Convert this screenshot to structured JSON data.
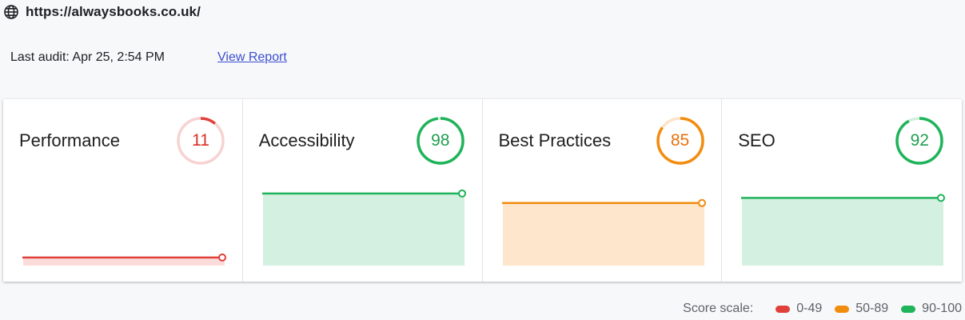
{
  "site": {
    "url": "https://alwaysbooks.co.uk/",
    "icon": "globe-icon"
  },
  "audit": {
    "last_audit": "Last audit: Apr 25, 2:54 PM",
    "view_report": "View Report"
  },
  "categories": [
    {
      "key": "performance",
      "label": "Performance",
      "score": "11",
      "value": 11,
      "level": "poor"
    },
    {
      "key": "accessibility",
      "label": "Accessibility",
      "score": "98",
      "value": 98,
      "level": "good"
    },
    {
      "key": "best-practices",
      "label": "Best Practices",
      "score": "85",
      "value": 85,
      "level": "average"
    },
    {
      "key": "seo",
      "label": "SEO",
      "score": "92",
      "value": 92,
      "level": "good"
    }
  ],
  "colors": {
    "poor": {
      "stroke": "#e0403a",
      "track": "#f6d3d1",
      "fill": "#fbdcdb",
      "text": "#d93025"
    },
    "average": {
      "stroke": "#f28c0f",
      "track": "#fde3c8",
      "fill": "#fee6cc",
      "text": "#e8710a"
    },
    "good": {
      "stroke": "#1fb35a",
      "track": "#d3efdc",
      "fill": "#d3f0e0",
      "text": "#1e9e4e"
    }
  },
  "legend": {
    "title": "Score scale:",
    "items": [
      {
        "label": "0-49",
        "level": "poor"
      },
      {
        "label": "50-89",
        "level": "average"
      },
      {
        "label": "90-100",
        "level": "good"
      }
    ]
  }
}
